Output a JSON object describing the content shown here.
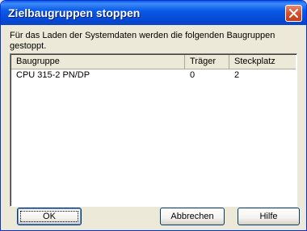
{
  "dialog": {
    "title": "Zielbaugruppen stoppen",
    "message": "Für das Laden der Systemdaten werden die folgenden Baugruppen gestoppt."
  },
  "list": {
    "columns": [
      "Baugruppe",
      "Träger",
      "Steckplatz"
    ],
    "rows": [
      {
        "baugruppe": "CPU 315-2 PN/DP",
        "traeger": "0",
        "steckplatz": "2"
      }
    ]
  },
  "buttons": {
    "ok": "OK",
    "cancel": "Abbrechen",
    "help": "Hilfe"
  },
  "icons": {
    "close": "close-icon"
  }
}
